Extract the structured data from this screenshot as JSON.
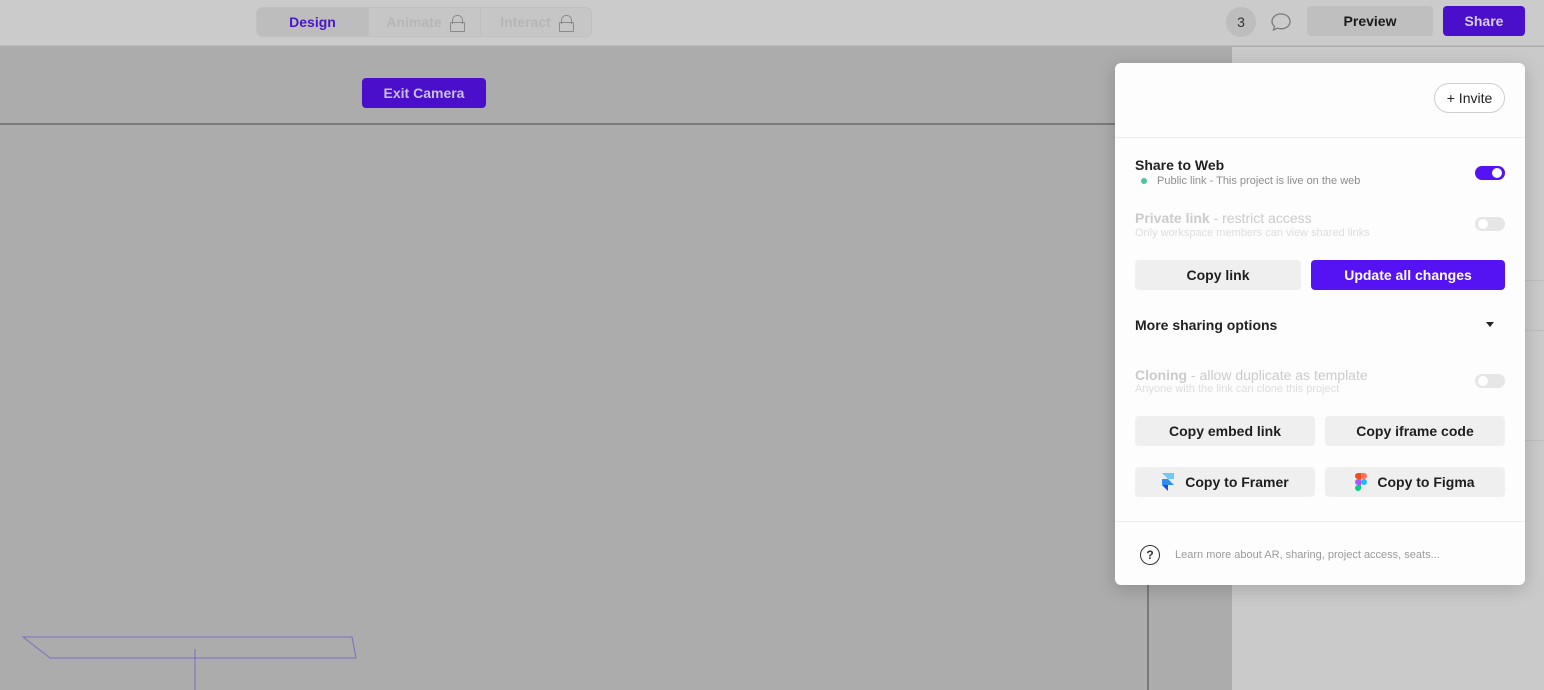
{
  "topbar": {
    "modes": [
      {
        "label": "Design",
        "active": true,
        "locked": false
      },
      {
        "label": "Animate",
        "active": false,
        "locked": true
      },
      {
        "label": "Interact",
        "active": false,
        "locked": true
      }
    ],
    "collaborator_count": "3",
    "comment_icon": "speech-bubble-icon",
    "preview_label": "Preview",
    "share_label": "Share"
  },
  "canvas": {
    "exit_camera_label": "Exit Camera"
  },
  "share_popover": {
    "invite_label": "+ Invite",
    "share_to_web": {
      "title": "Share to Web",
      "subtitle": "Public link - This project is live on the web",
      "status_color": "#4fc39a",
      "enabled": true
    },
    "private_link": {
      "title_bold": "Private link",
      "title_rest": " - restrict access",
      "subtitle": "Only workspace members can view shared links",
      "enabled": false
    },
    "copy_link_label": "Copy link",
    "update_label": "Update all changes",
    "more_options_label": "More sharing options",
    "cloning": {
      "title_bold": "Cloning",
      "title_rest": " - allow duplicate as template",
      "subtitle": "Anyone with the link can clone this project",
      "enabled": false
    },
    "copy_embed_label": "Copy embed link",
    "copy_iframe_label": "Copy iframe code",
    "copy_framer_label": "Copy to Framer",
    "copy_figma_label": "Copy to Figma",
    "help_text": "Learn more about AR, sharing, project access, seats..."
  },
  "colors": {
    "accent": "#5512f2",
    "accent_dimmed": "#4a0fcb"
  }
}
